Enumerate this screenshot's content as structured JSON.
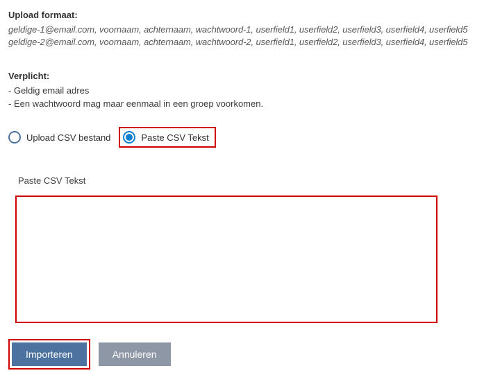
{
  "upload_format": {
    "title": "Upload formaat:",
    "examples": [
      "geldige-1@email.com, voornaam, achternaam, wachtwoord-1, userfield1, userfield2, userfield3, userfield4, userfield5",
      "geldige-2@email.com, voornaam, achternaam, wachtwoord-2, userfield1, userfield2, userfield3, userfield4, userfield5"
    ]
  },
  "required": {
    "title": "Verplicht:",
    "items": [
      "- Geldig email adres",
      "- Een wachtwoord mag maar eenmaal in een groep voorkomen."
    ]
  },
  "radio": {
    "upload_label": "Upload CSV bestand",
    "paste_label": "Paste CSV Tekst",
    "selected": "paste"
  },
  "textarea": {
    "label": "Paste CSV Tekst",
    "value": ""
  },
  "buttons": {
    "import": "Importeren",
    "cancel": "Annuleren"
  }
}
